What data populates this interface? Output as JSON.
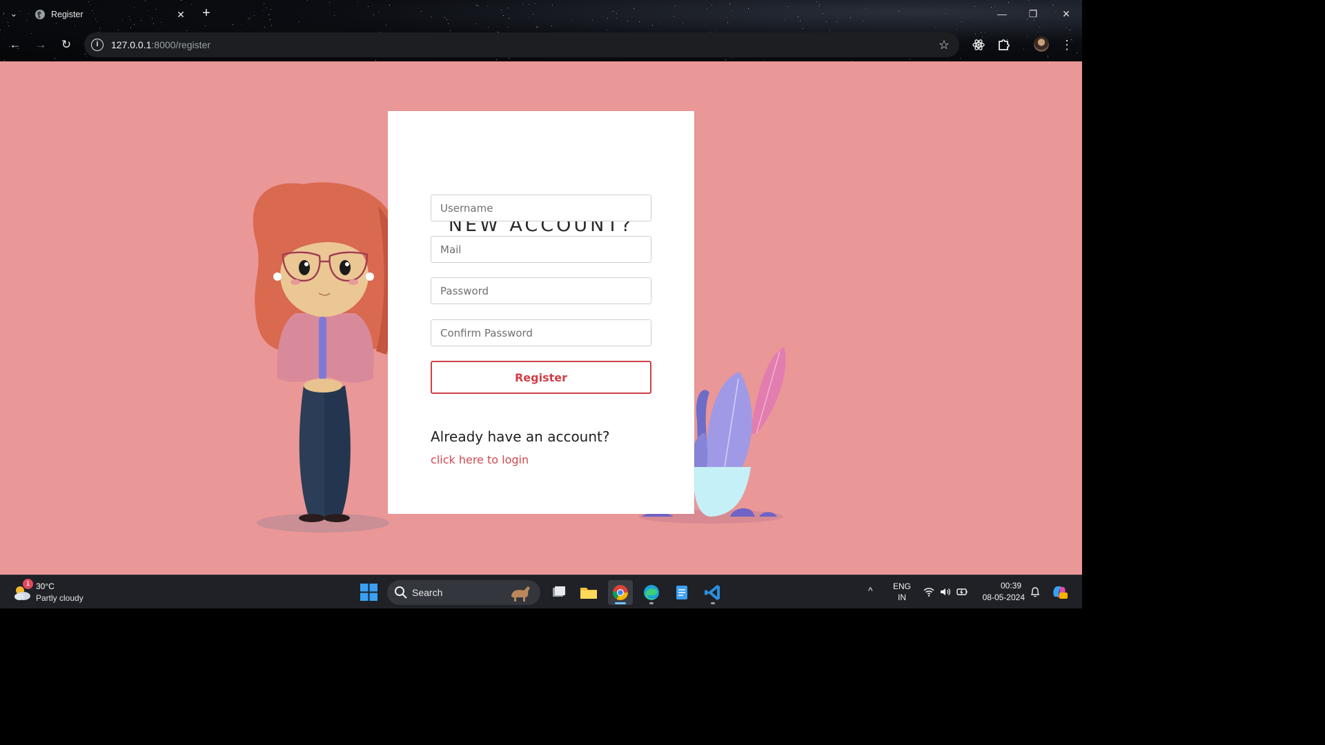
{
  "browser": {
    "tab_title": "Register",
    "url_host": "127.0.0.1",
    "url_rest": ":8000/register",
    "site_info_glyph": "i"
  },
  "form": {
    "title": "NEW ACCOUNT?",
    "username_placeholder": "Username",
    "mail_placeholder": "Mail",
    "password_placeholder": "Password",
    "confirm_password_placeholder": "Confirm Password",
    "register_label": "Register",
    "already_text": "Already have an account?",
    "login_link": "click here to login"
  },
  "taskbar": {
    "weather_badge": "1",
    "weather_temp": "30°C",
    "weather_desc": "Partly cloudy",
    "search_label": "Search",
    "lang_line1": "ENG",
    "lang_line2": "IN",
    "time": "00:39",
    "date": "08-05-2024"
  },
  "colors": {
    "page_background": "#ea9797",
    "accent_red": "#cf3f46"
  }
}
